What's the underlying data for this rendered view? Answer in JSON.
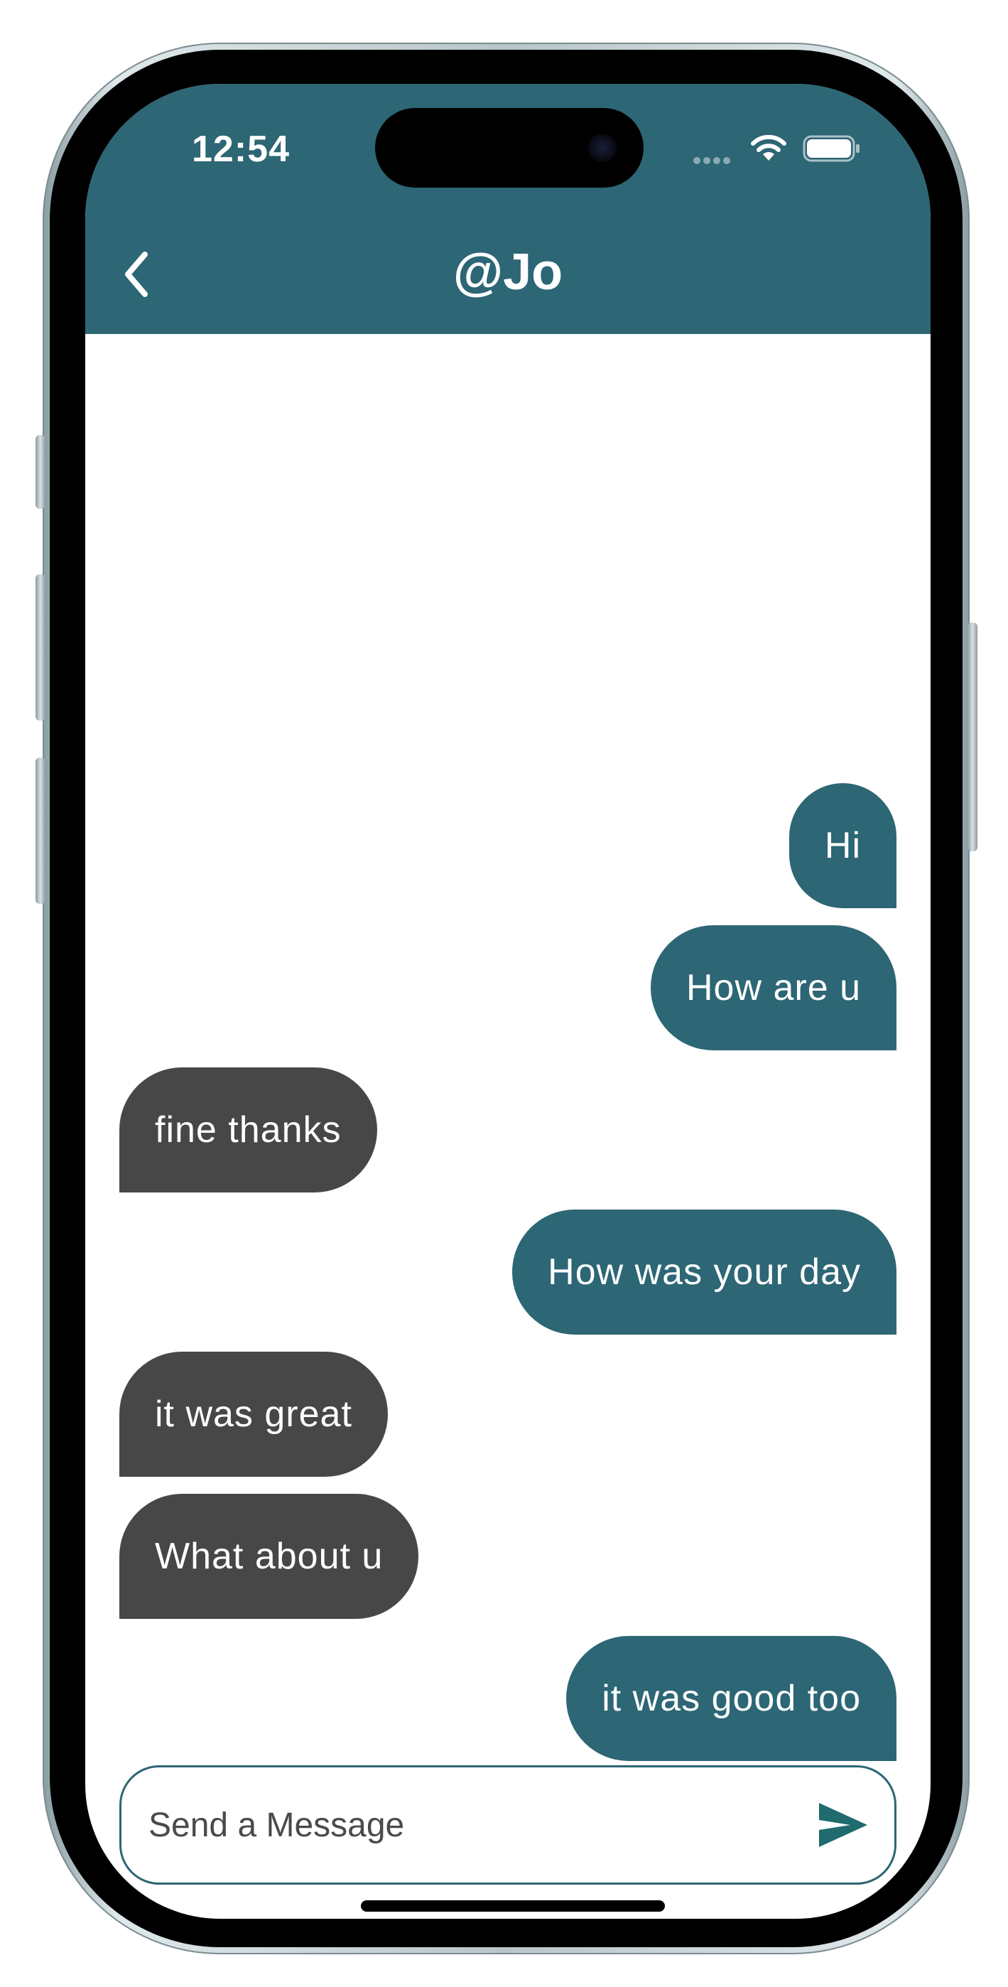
{
  "status_bar": {
    "time": "12:54"
  },
  "header": {
    "title": "@Jo",
    "back_icon": "chevron-left-icon"
  },
  "messages": [
    {
      "text": "Hi",
      "direction": "sent"
    },
    {
      "text": "How are u",
      "direction": "sent"
    },
    {
      "text": "fine thanks",
      "direction": "received"
    },
    {
      "text": "How was your day",
      "direction": "sent"
    },
    {
      "text": "it was great",
      "direction": "received"
    },
    {
      "text": "What about u",
      "direction": "received"
    },
    {
      "text": "it was good too",
      "direction": "sent"
    }
  ],
  "composer": {
    "placeholder": "Send a Message",
    "value": "",
    "send_icon": "send-icon"
  },
  "colors": {
    "accent": "#2d6675",
    "sent_bubble": "#2d6675",
    "received_bubble": "#474747",
    "send_icon": "#1f6b6e"
  }
}
